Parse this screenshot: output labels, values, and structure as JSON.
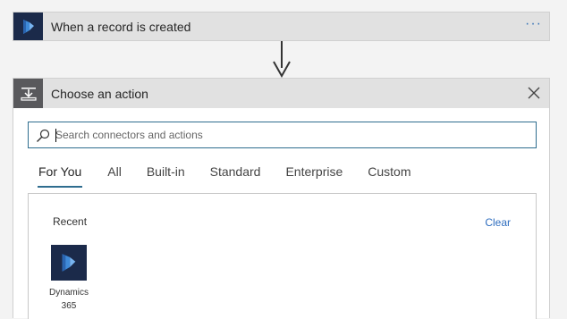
{
  "trigger": {
    "title": "When a record is created",
    "icon": "dynamics-365-icon",
    "more_label": "···"
  },
  "action_picker": {
    "title": "Choose an action",
    "icon": "action-step-icon",
    "search": {
      "placeholder": "Search connectors and actions",
      "value": ""
    },
    "tabs": [
      {
        "label": "For You",
        "active": true
      },
      {
        "label": "All",
        "active": false
      },
      {
        "label": "Built-in",
        "active": false
      },
      {
        "label": "Standard",
        "active": false
      },
      {
        "label": "Enterprise",
        "active": false
      },
      {
        "label": "Custom",
        "active": false
      }
    ],
    "recent": {
      "label": "Recent",
      "clear_label": "Clear",
      "connectors": [
        {
          "label_line1": "Dynamics",
          "label_line2": "365",
          "icon": "dynamics-365-icon"
        }
      ]
    }
  },
  "colors": {
    "accent": "#2f6d8f",
    "link": "#2f6ebf",
    "dynamics_bg": "#1b2a4a",
    "header_bg": "#e1e1e1"
  }
}
